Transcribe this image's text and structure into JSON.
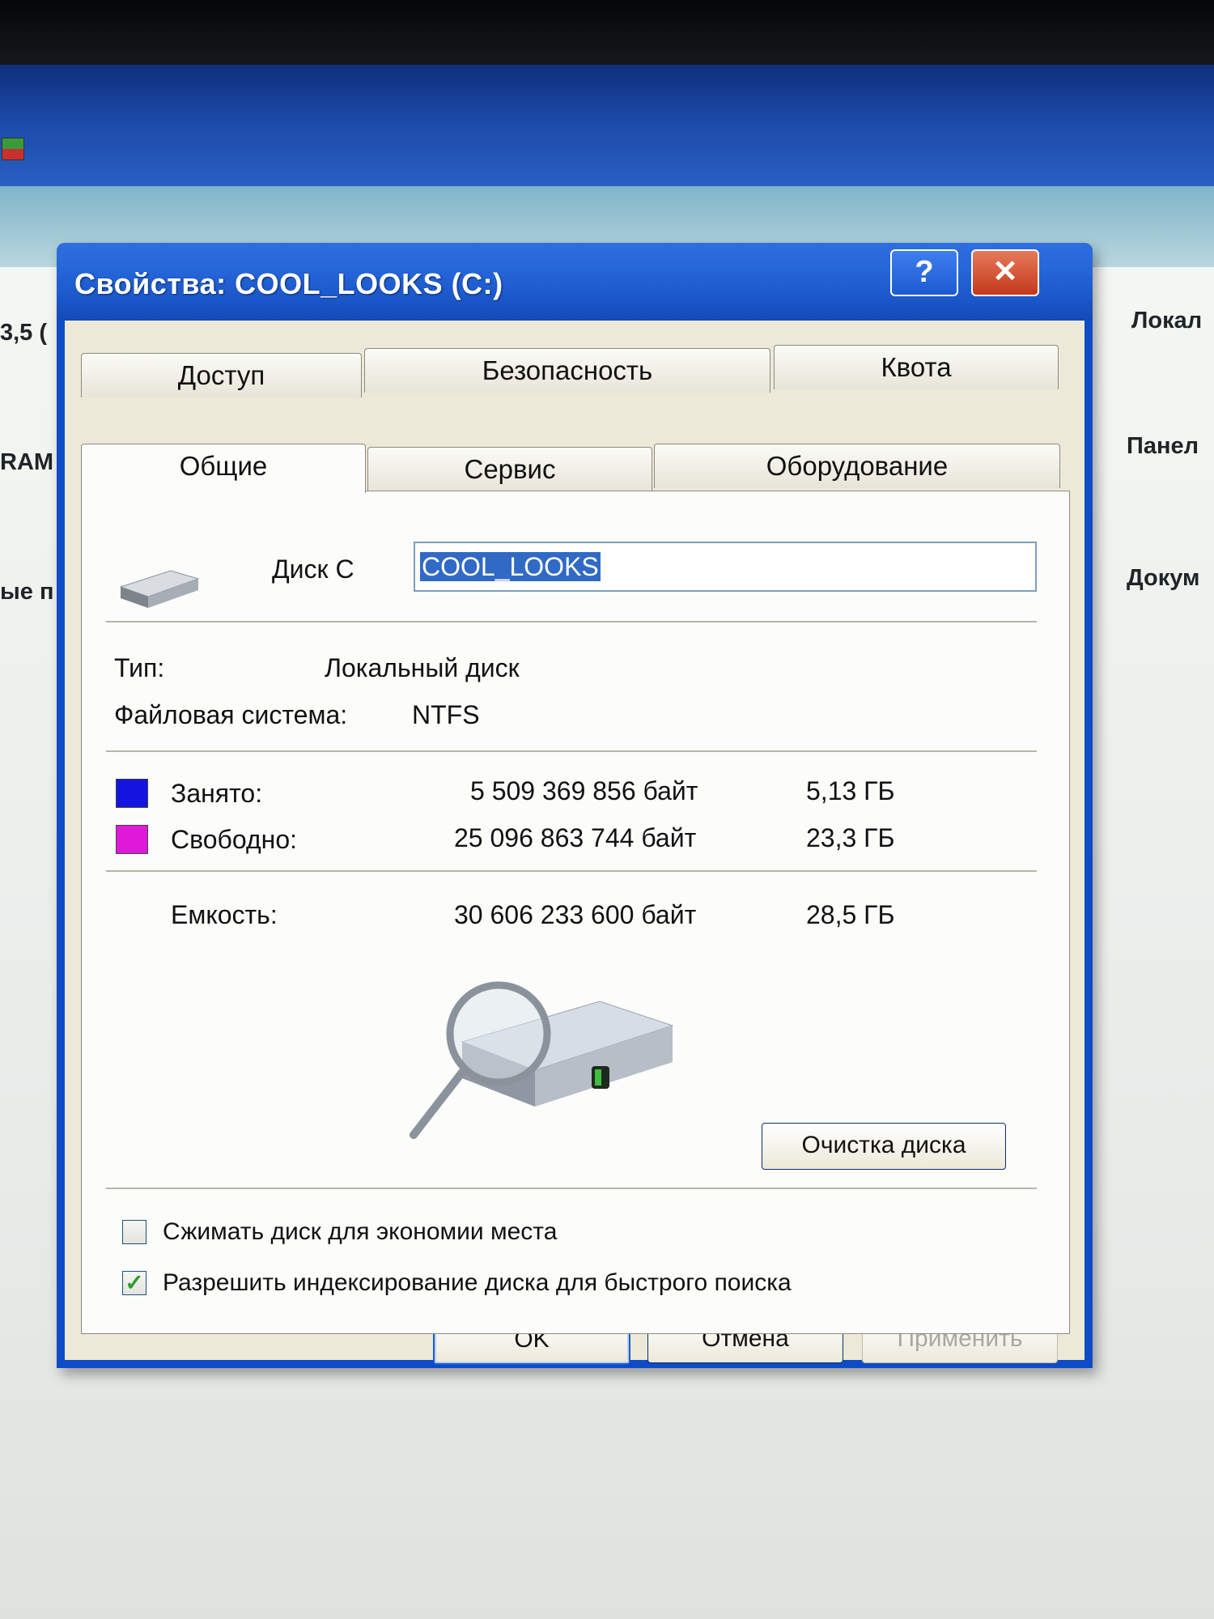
{
  "background": {
    "left_labels": [
      "3,5 (",
      "RAM",
      "ые п"
    ],
    "right_labels": [
      "Локал",
      "Панел",
      "Докум"
    ]
  },
  "dialog": {
    "title": "Свойства: COOL_LOOKS (C:)",
    "help_glyph": "?",
    "close_glyph": "✕",
    "tabs_row_back": [
      "Доступ",
      "Безопасность",
      "Квота"
    ],
    "tabs_row_front": [
      "Общие",
      "Сервис",
      "Оборудование"
    ],
    "active_tab": "Общие",
    "general": {
      "drive_label": "Диск C",
      "volume_name": "COOL_LOOKS",
      "type_label": "Тип:",
      "type_value": "Локальный диск",
      "fs_label": "Файловая система:",
      "fs_value": "NTFS",
      "used": {
        "label": "Занято:",
        "bytes": "5 509 369 856 байт",
        "size": "5,13 ГБ",
        "color": "#1414e0"
      },
      "free": {
        "label": "Свободно:",
        "bytes": "25 096 863 744 байт",
        "size": "23,3 ГБ",
        "color": "#e018d8"
      },
      "capacity": {
        "label": "Емкость:",
        "bytes": "30 606 233 600 байт",
        "size": "28,5 ГБ"
      },
      "cleanup_button": "Очистка диска",
      "compress_label": "Сжимать диск для экономии места",
      "compress_checked": false,
      "index_label": "Разрешить индексирование диска для быстрого поиска",
      "index_checked": true,
      "check_glyph": "✓"
    },
    "buttons": {
      "ok": "OK",
      "cancel": "Отмена",
      "apply": "Применить"
    }
  }
}
